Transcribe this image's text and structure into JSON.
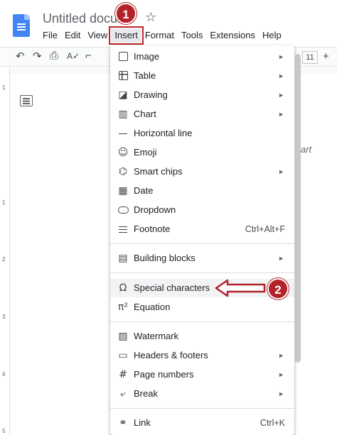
{
  "header": {
    "doc_title": "Untitled docum",
    "menu": [
      "File",
      "Edit",
      "View",
      "Insert",
      "Format",
      "Tools",
      "Extensions",
      "Help"
    ],
    "active_menu": "Insert"
  },
  "annotations": {
    "badge1": "1",
    "badge2": "2",
    "accent_color": "#b3222a"
  },
  "toolbar": {
    "font_size": "11",
    "plus": "+"
  },
  "ruler": [
    "1",
    "1",
    "2",
    "3",
    "4",
    "5"
  ],
  "page": {
    "ghost_text": "art"
  },
  "insert_menu": {
    "items": [
      {
        "label": "Image",
        "icon": "image-icon",
        "submenu": true
      },
      {
        "label": "Table",
        "icon": "table-icon",
        "submenu": true
      },
      {
        "label": "Drawing",
        "icon": "drawing-icon",
        "submenu": true
      },
      {
        "label": "Chart",
        "icon": "chart-icon",
        "submenu": true
      },
      {
        "label": "Horizontal line",
        "icon": "horizontal-line-icon",
        "submenu": false
      },
      {
        "label": "Emoji",
        "icon": "emoji-icon",
        "submenu": false
      },
      {
        "label": "Smart chips",
        "icon": "smart-chips-icon",
        "submenu": true
      },
      {
        "label": "Date",
        "icon": "date-icon",
        "submenu": false
      },
      {
        "label": "Dropdown",
        "icon": "dropdown-icon",
        "submenu": false
      },
      {
        "label": "Footnote",
        "icon": "footnote-icon",
        "shortcut": "Ctrl+Alt+F"
      },
      {
        "label": "Building blocks",
        "icon": "building-blocks-icon",
        "submenu": true
      },
      {
        "label": "Special characters",
        "icon": "omega-icon",
        "highlighted": true
      },
      {
        "label": "Equation",
        "icon": "pi-icon"
      },
      {
        "label": "Watermark",
        "icon": "watermark-icon"
      },
      {
        "label": "Headers & footers",
        "icon": "headers-footers-icon",
        "submenu": true
      },
      {
        "label": "Page numbers",
        "icon": "hash-icon",
        "submenu": true
      },
      {
        "label": "Break",
        "icon": "break-icon",
        "submenu": true
      },
      {
        "label": "Link",
        "icon": "link-icon",
        "shortcut": "Ctrl+K"
      }
    ]
  }
}
